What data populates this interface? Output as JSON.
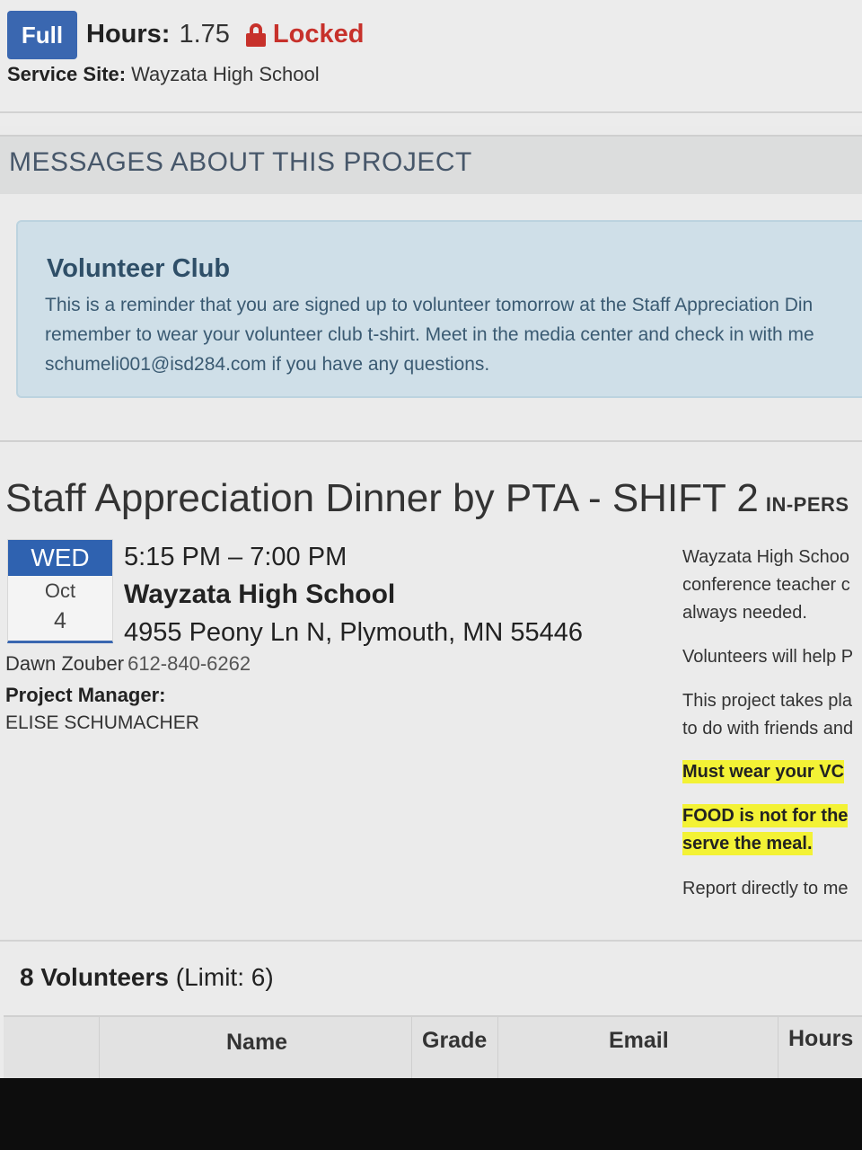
{
  "header": {
    "status_badge": "Full",
    "hours_label": "Hours:",
    "hours_value": "1.75",
    "locked_label": "Locked",
    "service_site_label": "Service Site:",
    "service_site_value": "Wayzata High School"
  },
  "messages": {
    "section_title": "MESSAGES ABOUT THIS PROJECT",
    "alert_title": "Volunteer Club",
    "alert_lines": [
      "This is a reminder that you are signed up to volunteer tomorrow at the Staff Appreciation Din",
      "remember to wear your volunteer club t-shirt. Meet in the media center and check in with me",
      "schumeli001@isd284.com if you have any questions."
    ]
  },
  "project": {
    "title": "Staff Appreciation Dinner by PTA - SHIFT 2",
    "mode_tag": "IN-PERS",
    "calendar": {
      "dow": "WED",
      "month": "Oct",
      "day": "4"
    },
    "time": "5:15 PM – 7:00 PM",
    "venue": "Wayzata High School",
    "address": "4955 Peony Ln N, Plymouth, MN 55446",
    "contact_name": "Dawn Zouber",
    "contact_phone": "612-840-6262",
    "manager_label": "Project Manager:",
    "manager_name": "ELISE SCHUMACHER",
    "description": {
      "p1_lines": [
        "Wayzata High Schoo",
        "conference teacher c",
        "always needed."
      ],
      "p2": "Volunteers will help P",
      "p3_lines": [
        "This project takes pla",
        "to do with friends and"
      ],
      "highlight1": "Must wear your VC",
      "highlight2_lines": [
        "FOOD is not for the",
        "serve the meal."
      ],
      "p4": "Report directly to me"
    }
  },
  "volunteers": {
    "count": "8 Volunteers",
    "limit": "(Limit: 6)",
    "columns": [
      "Name",
      "Grade",
      "Email",
      "Hours"
    ]
  },
  "colors": {
    "badge_blue": "#3a67b0",
    "locked_red": "#c7312b",
    "alert_bg": "#cfdfe8",
    "highlight_yellow": "#f3f235"
  }
}
